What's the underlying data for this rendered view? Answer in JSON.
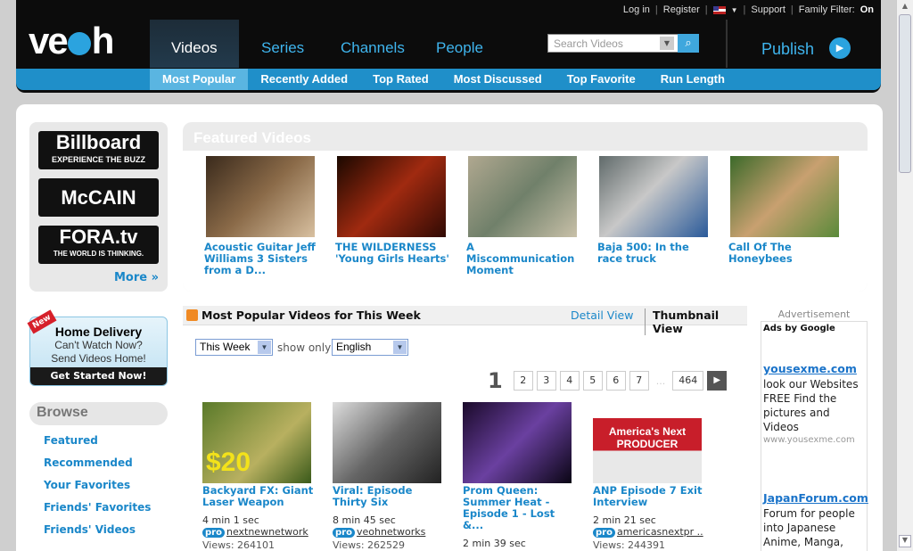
{
  "util": {
    "login": "Log in",
    "register": "Register",
    "support": "Support",
    "family_filter": "Family Filter:",
    "family_on": "On"
  },
  "logo": "veoh",
  "nav": {
    "videos": "Videos",
    "series": "Series",
    "channels": "Channels",
    "people": "People",
    "publish": "Publish"
  },
  "search": {
    "placeholder": "Search Videos"
  },
  "subnav": [
    "Most Popular",
    "Recently Added",
    "Top Rated",
    "Most Discussed",
    "Top Favorite",
    "Run Length"
  ],
  "sponsors": {
    "billboard": "Billboard",
    "billboard_tag": "EXPERIENCE THE BUZZ",
    "mccain": "McCAIN",
    "fora": "FORA.tv",
    "fora_tag": "THE WORLD IS THINKING.",
    "more": "More »"
  },
  "promo": {
    "badge": "New",
    "title": "Home Delivery",
    "line1": "Can't Watch Now?",
    "line2": "Send Videos Home!",
    "cta": "Get Started Now!"
  },
  "browse": {
    "title": "Browse",
    "items": [
      "Featured",
      "Recommended",
      "Your Favorites",
      "Friends' Favorites",
      "Friends' Videos"
    ]
  },
  "featured": {
    "title": "Featured Videos",
    "items": [
      {
        "caption": "Acoustic Guitar Jeff Williams 3 Sisters from a D..."
      },
      {
        "caption": "THE WILDERNESS 'Young Girls Hearts'"
      },
      {
        "caption": "A Miscommunication Moment"
      },
      {
        "caption": "Baja 500: In the race truck"
      },
      {
        "caption": "Call Of The Honeybees"
      }
    ]
  },
  "popular": {
    "title": "Most Popular Videos for This Week",
    "detail_view": "Detail View",
    "thumbnail_view": "Thumbnail View",
    "period": "This Week",
    "show_only": "show only",
    "language": "English",
    "current_page": "1",
    "pages": [
      "2",
      "3",
      "4",
      "5",
      "6",
      "7"
    ],
    "dots": "...",
    "last_page": "464",
    "next": "▶",
    "videos": [
      {
        "title": "Backyard FX: Giant Laser Weapon",
        "duration": "4 min 1 sec",
        "pro": "pro",
        "user": "nextnewnetwork",
        "views": "Views: 264101",
        "thumb_text": "$20"
      },
      {
        "title": "Viral: Episode Thirty Six",
        "duration": "8 min 45 sec",
        "pro": "pro",
        "user": "veohnetworks",
        "views": "Views: 262529"
      },
      {
        "title": "Prom Queen: Summer Heat - Episode 1 - Lost &...",
        "duration": "2 min 39 sec"
      },
      {
        "title": "ANP Episode 7 Exit Interview",
        "duration": "2 min 21 sec",
        "pro": "pro",
        "user": "americasnextpr ..",
        "views": "Views: 244391",
        "thumb_text": "America's Next PRODUCER"
      }
    ]
  },
  "ads": {
    "label": "Advertisement",
    "ads_by": "Ads by Google",
    "items": [
      {
        "title": "yousexme.com",
        "text": "look our Websites FREE Find the pictures and Videos",
        "url": "www.yousexme.com"
      },
      {
        "title": "JapanForum.com",
        "text": "Forum for people into Japanese Anime, Manga, and"
      }
    ]
  }
}
